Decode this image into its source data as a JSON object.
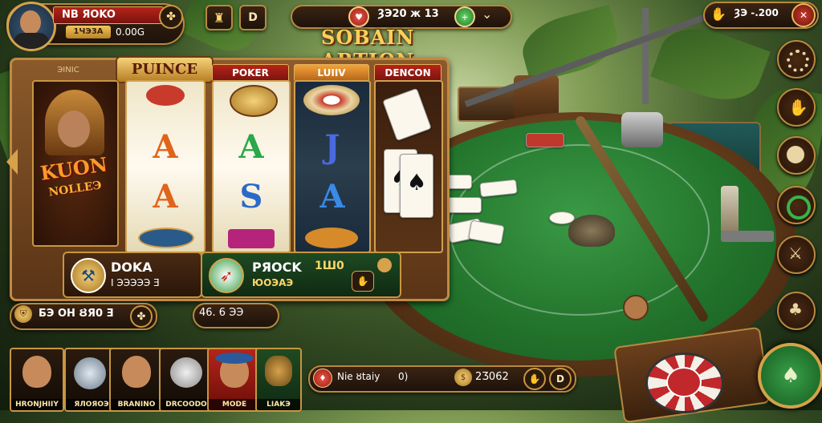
{
  "profile": {
    "name": "NB ЯOKO",
    "level_badge": "1ЧЭ3А",
    "coins": "0.00G"
  },
  "top_buttons": {
    "shop_icon": "chest-icon",
    "info_label": "D"
  },
  "room_bar": {
    "balance": "ȜЭ20 ж 13",
    "chevron": "⌄"
  },
  "top_right": {
    "value": "ȜЭ -.200"
  },
  "game_title": "SOBAIN ARTION",
  "slot": {
    "banner": "PUINCE",
    "column_headers": [
      "POKER",
      "LUIIV",
      "DENCON"
    ],
    "left_header": "ЭINIC",
    "mascot_text": "KUON",
    "mascot_sub": "NOLLЕЭ",
    "reel1": [
      "A",
      "A"
    ],
    "reel2": [
      "A",
      "S"
    ],
    "reel3": [
      "J",
      "A"
    ],
    "bottom_left": {
      "title": "DOKA",
      "value": "I ЭЭЭЭЭ Ǝ"
    },
    "bottom_mid": {
      "title": "PЯOCK",
      "value": "ЮОЭАЭ",
      "badge": "1Ш0"
    }
  },
  "wallet": {
    "text": "БЭ OH ȢЯ0 Ǝ"
  },
  "bet_chip": {
    "text": "46. 6 ЭЭ"
  },
  "status_bar": {
    "left": "Nie ȣtaiy",
    "mid": "0)",
    "right": "2Ӡ062"
  },
  "players": [
    {
      "name": "HRONJHIIY"
    },
    {
      "name": "ЯЛОЯОЭ"
    },
    {
      "name": "BRANINO"
    },
    {
      "name": "DRCOODO"
    },
    {
      "name": "MODE"
    },
    {
      "name": "LIAKЭ"
    }
  ],
  "side_buttons": [
    {
      "icon": "gear-icon"
    },
    {
      "icon": "hand-icon"
    },
    {
      "icon": "coin-icon"
    },
    {
      "icon": "chip-icon"
    },
    {
      "icon": "swords-icon"
    },
    {
      "icon": "clover-icon"
    }
  ],
  "colors": {
    "gold": "#ffd56a",
    "felt": "#23742c",
    "wood": "#6b3f1d",
    "red_header": "#9b1a12"
  }
}
